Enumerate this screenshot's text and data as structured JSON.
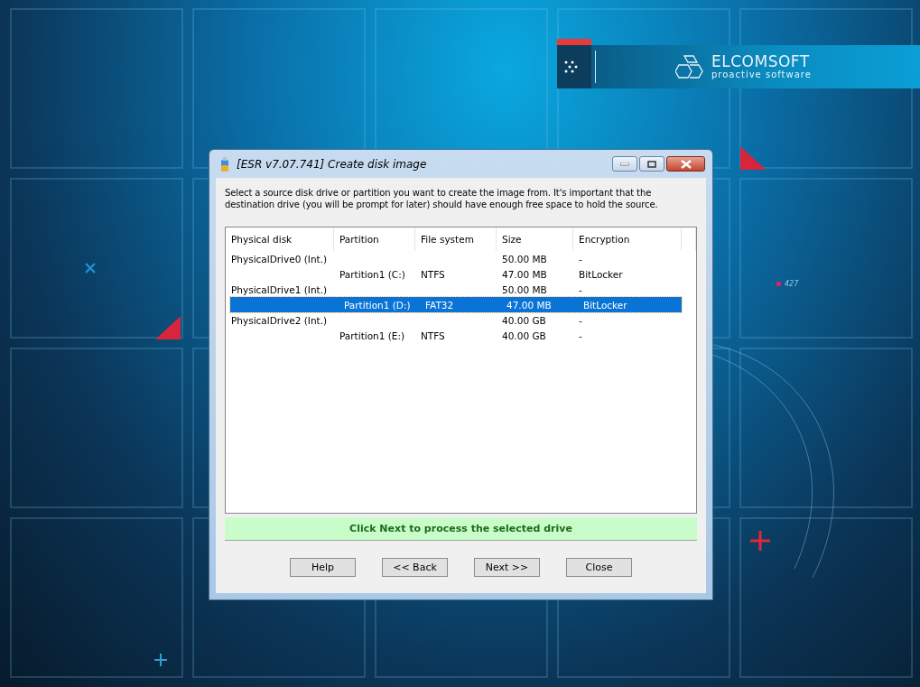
{
  "banner": {
    "brand": "ELCOMSOFT",
    "tagline": "proactive software"
  },
  "backdrop": {
    "marker": "427"
  },
  "window": {
    "title": "[ESR v7.07.741]  Create disk image"
  },
  "instruction": "Select a source disk drive or partition you want to create the image from. It's important that the destination drive (you will be prompt for later) should have enough free space to hold the source.",
  "table": {
    "columns": [
      "Physical disk",
      "Partition",
      "File system",
      "Size",
      "Encryption"
    ],
    "rows": [
      {
        "cells": [
          "PhysicalDrive0 (Int.)",
          "",
          "",
          "50.00 MB",
          "-"
        ],
        "selected": false
      },
      {
        "cells": [
          "",
          "Partition1 (C:)",
          "NTFS",
          "47.00 MB",
          "BitLocker"
        ],
        "selected": false
      },
      {
        "cells": [
          "PhysicalDrive1 (Int.)",
          "",
          "",
          "50.00 MB",
          "-"
        ],
        "selected": false
      },
      {
        "cells": [
          "",
          "Partition1 (D:)",
          "FAT32",
          "47.00 MB",
          "BitLocker"
        ],
        "selected": true
      },
      {
        "cells": [
          "PhysicalDrive2 (Int.)",
          "",
          "",
          "40.00 GB",
          "-"
        ],
        "selected": false
      },
      {
        "cells": [
          "",
          "Partition1 (E:)",
          "NTFS",
          "40.00 GB",
          "-"
        ],
        "selected": false
      }
    ]
  },
  "status": "Click Next to process the selected drive",
  "buttons": [
    "Help",
    "<< Back",
    "Next >>",
    "Close"
  ]
}
